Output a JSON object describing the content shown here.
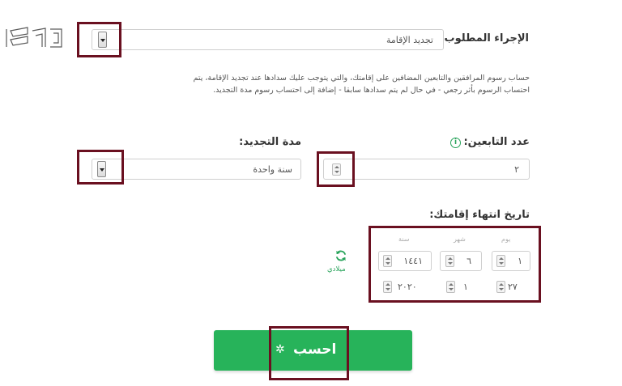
{
  "procedure": {
    "label": "الإجراء المطلوب:",
    "value": "تجديد الإقامة"
  },
  "description": {
    "line1": "حساب رسوم المرافقين والتابعين المضافين على إقامتك، والتي يتوجب عليك سدادها عند تجديد الإقامة، يتم",
    "line2": "احتساب الرسوم بأثر رجعي - في حال لم يتم سدادها سابقا - إضافة إلى احتساب رسوم مدة التجديد."
  },
  "dependents": {
    "label": "عدد التابعين:",
    "value": "٢",
    "info_icon": "info-icon"
  },
  "renewal": {
    "label": "مدة التجديد:",
    "value": "سنة واحدة"
  },
  "expiry": {
    "label": "تاريخ انتهاء إقامتك:",
    "col_day": "يوم",
    "col_month": "شهر",
    "col_year": "سنة",
    "hijri": {
      "day": "١",
      "month": "٦",
      "year": "١٤٤١"
    },
    "gregorian": {
      "day": "٢٧",
      "month": "١",
      "year": "٢٠٢٠"
    },
    "toggle_label": "ميلادي"
  },
  "calculate": {
    "label": "احسب"
  },
  "colors": {
    "accent_green": "#27b35a",
    "highlight_border": "#6a1020"
  }
}
